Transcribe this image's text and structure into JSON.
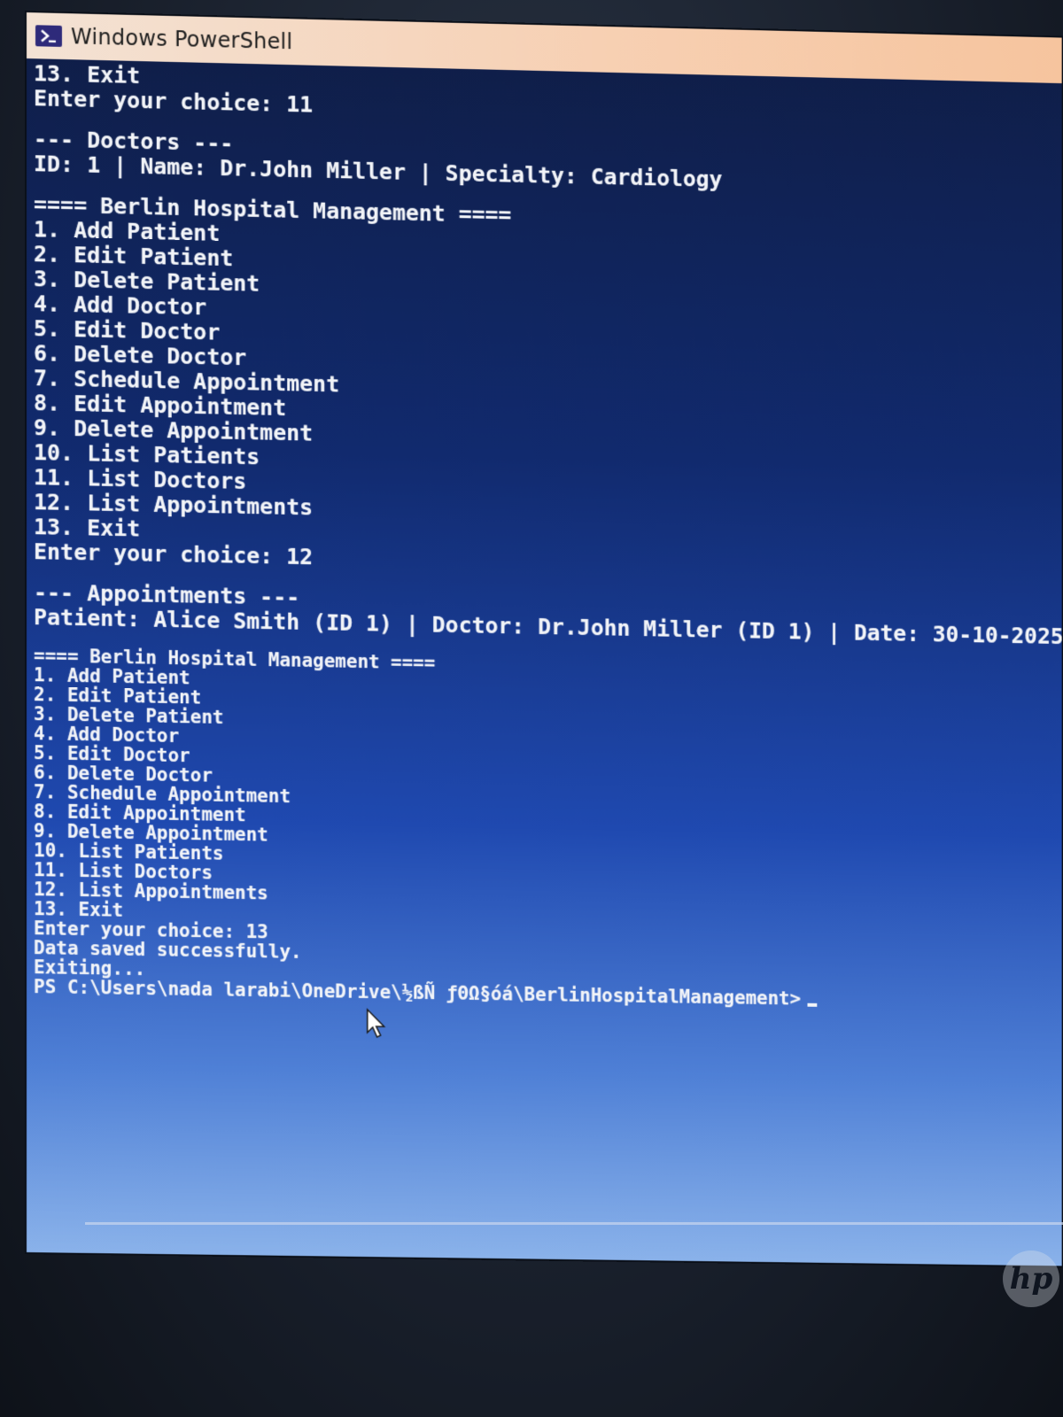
{
  "window": {
    "title": "Windows PowerShell",
    "icon": "powershell-icon"
  },
  "console": {
    "lines_top": [
      "13. Exit",
      "Enter your choice: 11",
      "",
      "--- Doctors ---",
      "ID: 1 | Name: Dr.John Miller | Specialty: Cardiology",
      "",
      "==== Berlin Hospital Management ====",
      "1. Add Patient",
      "2. Edit Patient",
      "3. Delete Patient",
      "4. Add Doctor",
      "5. Edit Doctor",
      "6. Delete Doctor",
      "7. Schedule Appointment",
      "8. Edit Appointment",
      "9. Delete Appointment",
      "10. List Patients",
      "11. List Doctors",
      "12. List Appointments",
      "13. Exit",
      "Enter your choice: 12",
      "",
      "--- Appointments ---",
      "Patient: Alice Smith (ID 1) | Doctor: Dr.John Miller (ID 1) | Date: 30-10-2025"
    ],
    "lines_bottom": [
      "",
      "==== Berlin Hospital Management ====",
      "1. Add Patient",
      "2. Edit Patient",
      "3. Delete Patient",
      "4. Add Doctor",
      "5. Edit Doctor",
      "6. Delete Doctor",
      "7. Schedule Appointment",
      "8. Edit Appointment",
      "9. Delete Appointment",
      "10. List Patients",
      "11. List Doctors",
      "12. List Appointments",
      "13. Exit",
      "Enter your choice: 13",
      "Data saved successfully.",
      "Exiting..."
    ],
    "prompt": "PS C:\\Users\\nada larabi\\OneDrive\\½ßÑ ƒΘΩ§óá\\BerlinHospitalManagement>"
  },
  "laptop": {
    "brand_logo": "hp"
  }
}
